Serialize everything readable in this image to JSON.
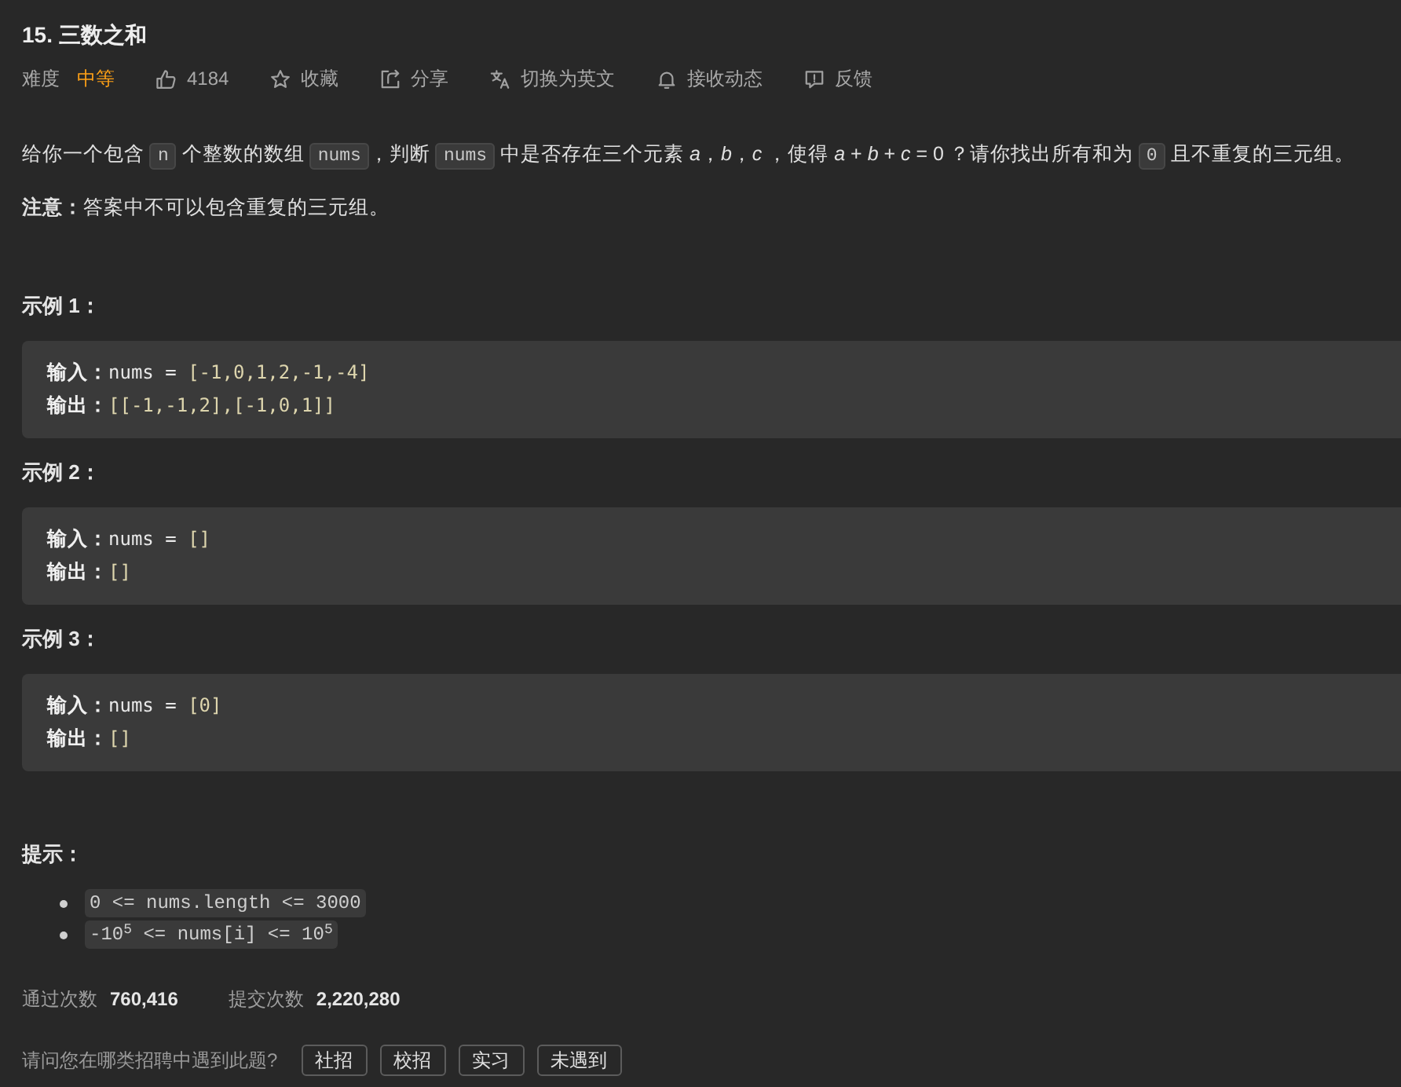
{
  "title": "15. 三数之和",
  "meta": {
    "difficulty_label": "难度",
    "difficulty": "中等",
    "actions": [
      {
        "kind": "like",
        "label": "4184"
      },
      {
        "kind": "favorite",
        "label": "收藏"
      },
      {
        "kind": "share",
        "label": "分享"
      },
      {
        "kind": "translate",
        "label": "切换为英文"
      },
      {
        "kind": "subscribe",
        "label": "接收动态"
      },
      {
        "kind": "feedback",
        "label": "反馈"
      }
    ]
  },
  "description": [
    {
      "kind": "text",
      "text": "给你一个包含 "
    },
    {
      "kind": "code",
      "text": "n"
    },
    {
      "kind": "text",
      "text": " 个整数的数组 "
    },
    {
      "kind": "code",
      "text": "nums"
    },
    {
      "kind": "text",
      "text": "，判断 "
    },
    {
      "kind": "code",
      "text": "nums"
    },
    {
      "kind": "text",
      "text": " 中是否存在三个元素 *a*，*b*，*c* ，使得 *a* + *b* + *c* = 0 ？请你找出所有和为 "
    },
    {
      "kind": "code",
      "text": "0"
    },
    {
      "kind": "text",
      "text": " 且不重复的三元组。"
    }
  ],
  "note": "**注意：**答案中不可以包含重复的三元组。",
  "examples": [
    {
      "title": "示例 1：",
      "lines": [
        {
          "label": "输入：",
          "code": "nums =",
          "literal": "[-1,0,1,2,-1,-4]"
        },
        {
          "label": "输出：",
          "literal": "[[-1,-1,2],[-1,0,1]]"
        }
      ]
    },
    {
      "title": "示例 2：",
      "lines": [
        {
          "label": "输入：",
          "code": "nums =",
          "literal": "[]"
        },
        {
          "label": "输出：",
          "literal": "[]"
        }
      ]
    },
    {
      "title": "示例 3：",
      "lines": [
        {
          "label": "输入：",
          "code": "nums =",
          "literal": "[0]"
        },
        {
          "label": "输出：",
          "literal": "[]"
        }
      ]
    }
  ],
  "hints": {
    "title": "提示：",
    "items": [
      "0 <= nums.length <= 3000",
      "-10$^{5}$ <= nums[i] <= 10$^{5}$"
    ]
  },
  "stats": [
    {
      "label": "通过次数",
      "value": "760,416"
    },
    {
      "label": "提交次数",
      "value": "2,220,280"
    }
  ],
  "survey": {
    "question": "请问您在哪类招聘中遇到此题?",
    "options": [
      {
        "label": "社招",
        "selected": false
      },
      {
        "label": "校招",
        "selected": false
      },
      {
        "label": "实习",
        "selected": false
      },
      {
        "label": "未遇到",
        "selected": false
      }
    ]
  }
}
